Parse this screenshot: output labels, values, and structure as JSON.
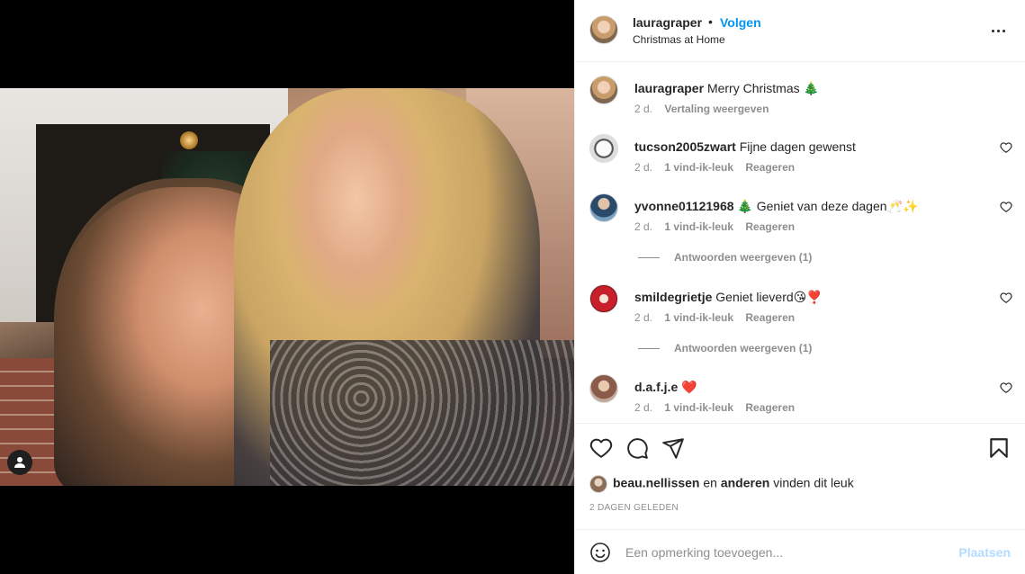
{
  "header": {
    "username": "lauragraper",
    "separator": "•",
    "follow_label": "Volgen",
    "location": "Christmas at Home"
  },
  "caption": {
    "username": "lauragraper",
    "text": "Merry Christmas 🎄",
    "age": "2 d.",
    "translate": "Vertaling weergeven"
  },
  "comments": [
    {
      "username": "tucson2005zwart",
      "text": "Fijne dagen gewenst",
      "age": "2 d.",
      "likes": "1 vind-ik-leuk",
      "reply": "Reageren"
    },
    {
      "username": "yvonne01121968",
      "text": "🎄 Geniet van deze dagen🥂✨",
      "age": "2 d.",
      "likes": "1 vind-ik-leuk",
      "reply": "Reageren",
      "view_replies": "Antwoorden weergeven (1)"
    },
    {
      "username": "smildegrietje",
      "text": "Geniet lieverd😘❣️",
      "age": "2 d.",
      "likes": "1 vind-ik-leuk",
      "reply": "Reageren",
      "view_replies": "Antwoorden weergeven (1)"
    },
    {
      "username": "d.a.f.j.e",
      "text": "❤️",
      "age": "2 d.",
      "likes": "1 vind-ik-leuk",
      "reply": "Reageren"
    }
  ],
  "likes_line": {
    "user": "beau.nellissen",
    "and": "en",
    "others": "anderen",
    "suffix": "vinden dit leuk"
  },
  "timestamp": "2 DAGEN GELEDEN",
  "add_comment": {
    "placeholder": "Een opmerking toevoegen...",
    "post_label": "Plaatsen"
  },
  "colors": {
    "link_blue": "#0095f6",
    "post_disabled": "#b3dbff",
    "secondary_text": "#8e8e8e",
    "border": "#efefef"
  },
  "icons": [
    "heart-icon",
    "comment-icon",
    "share-icon",
    "bookmark-icon",
    "emoji-icon",
    "more-icon",
    "user-tag-icon"
  ]
}
